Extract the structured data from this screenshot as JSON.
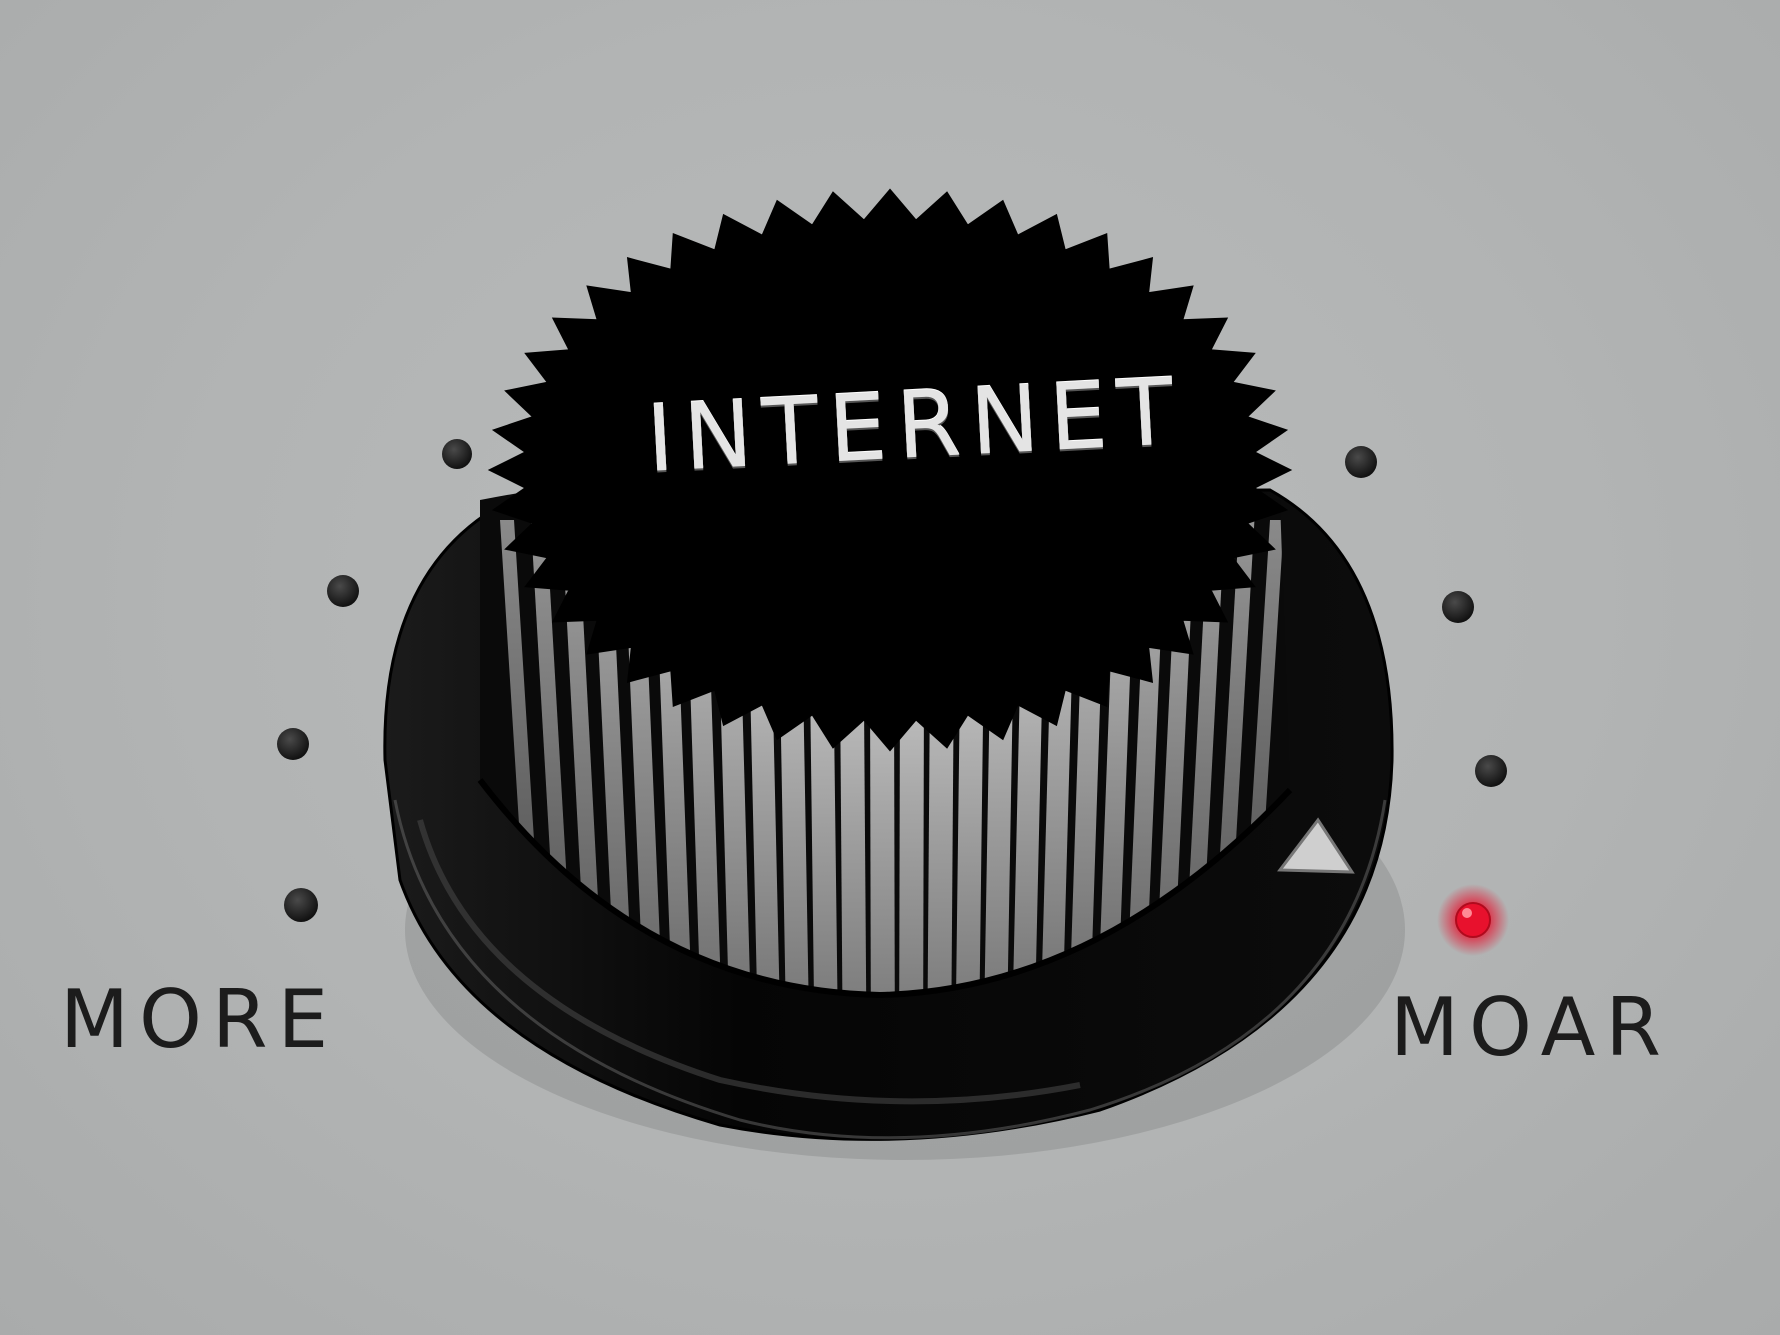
{
  "knob": {
    "label": "INTERNET",
    "body_color": "#000000",
    "rib_color": "#d8d8d8",
    "pointer_color": "#c8c8c8",
    "setting": "MOAR"
  },
  "scale": {
    "min_label": "MORE",
    "max_label": "MOAR",
    "indicator_color": "#e8112d",
    "panel_color": "#b3b5b5",
    "dot_color": "#1a1a1a"
  }
}
